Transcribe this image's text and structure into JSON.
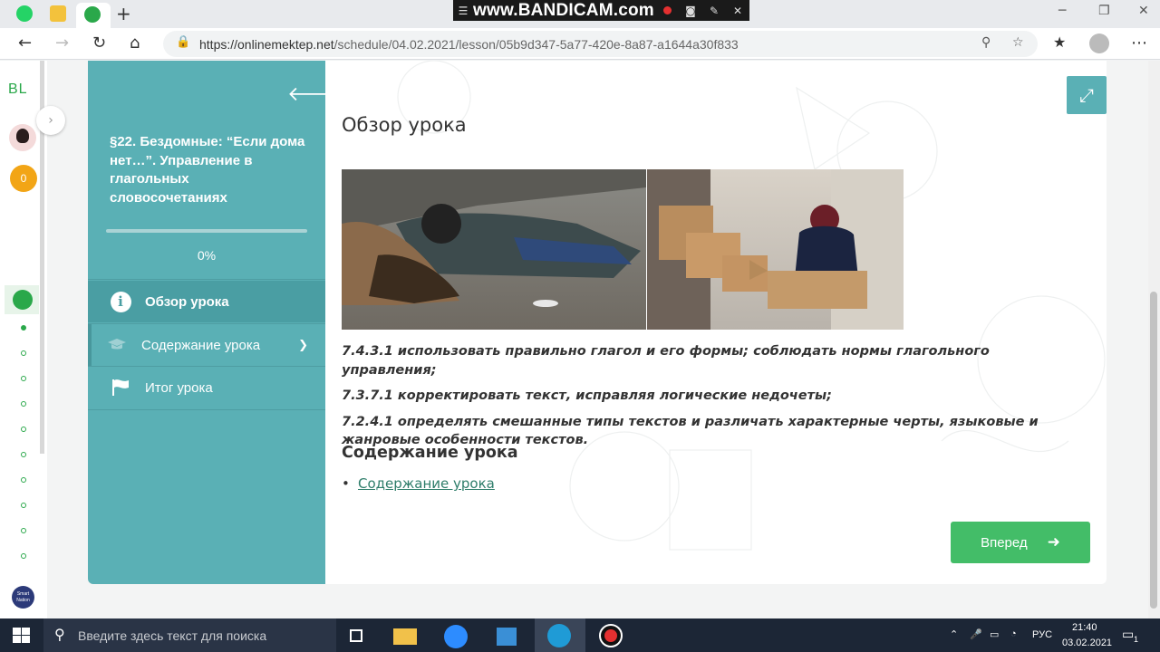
{
  "browser": {
    "url_host": "https://onlinemektep.net",
    "url_path": "/schedule/04.02.2021/lesson/05b9d347-5a77-420e-8a87-a1644a30f833",
    "new_tab_symbol": "+"
  },
  "recorder": {
    "watermark": "www.BANDICAM.com"
  },
  "rail": {
    "logo": "BL",
    "coins": "0",
    "smart_label": "Smart Nation"
  },
  "sidebar": {
    "lesson_title": "§22. Бездомные: “Если дома нет…”. Управление в глагольных словосочетаниях",
    "progress_percent": 0,
    "progress_label": "0%",
    "items": [
      {
        "label": "Обзор урока",
        "icon": "info-icon",
        "state": "active"
      },
      {
        "label": "Содержание урока",
        "icon": "graduation-cap-icon",
        "state": "expandable"
      },
      {
        "label": "Итог урока",
        "icon": "flag-icon",
        "state": "default"
      }
    ]
  },
  "main": {
    "section_title": "Обзор урока",
    "objectives": [
      "7.4.3.1 использовать правильно глагол и его формы; соблюдать нормы глагольного управления;",
      "7.3.7.1 корректировать текст, исправляя логические недочеты;",
      "7.2.4.1 определять смешанные типы текстов и различать характерные черты, языковые и жанровые особенности текстов."
    ],
    "content_heading": "Содержание урока",
    "content_links": [
      "Содержание урока"
    ],
    "next_button": "Вперед"
  },
  "taskbar": {
    "search_placeholder": "Введите здесь текст для поиска",
    "language": "РУС",
    "time": "21:40",
    "date": "03.02.2021",
    "notification_count": "1"
  },
  "colors": {
    "sidebar": "#5ab0b5",
    "accent_green": "#43bd68",
    "coin": "#f2a516"
  }
}
